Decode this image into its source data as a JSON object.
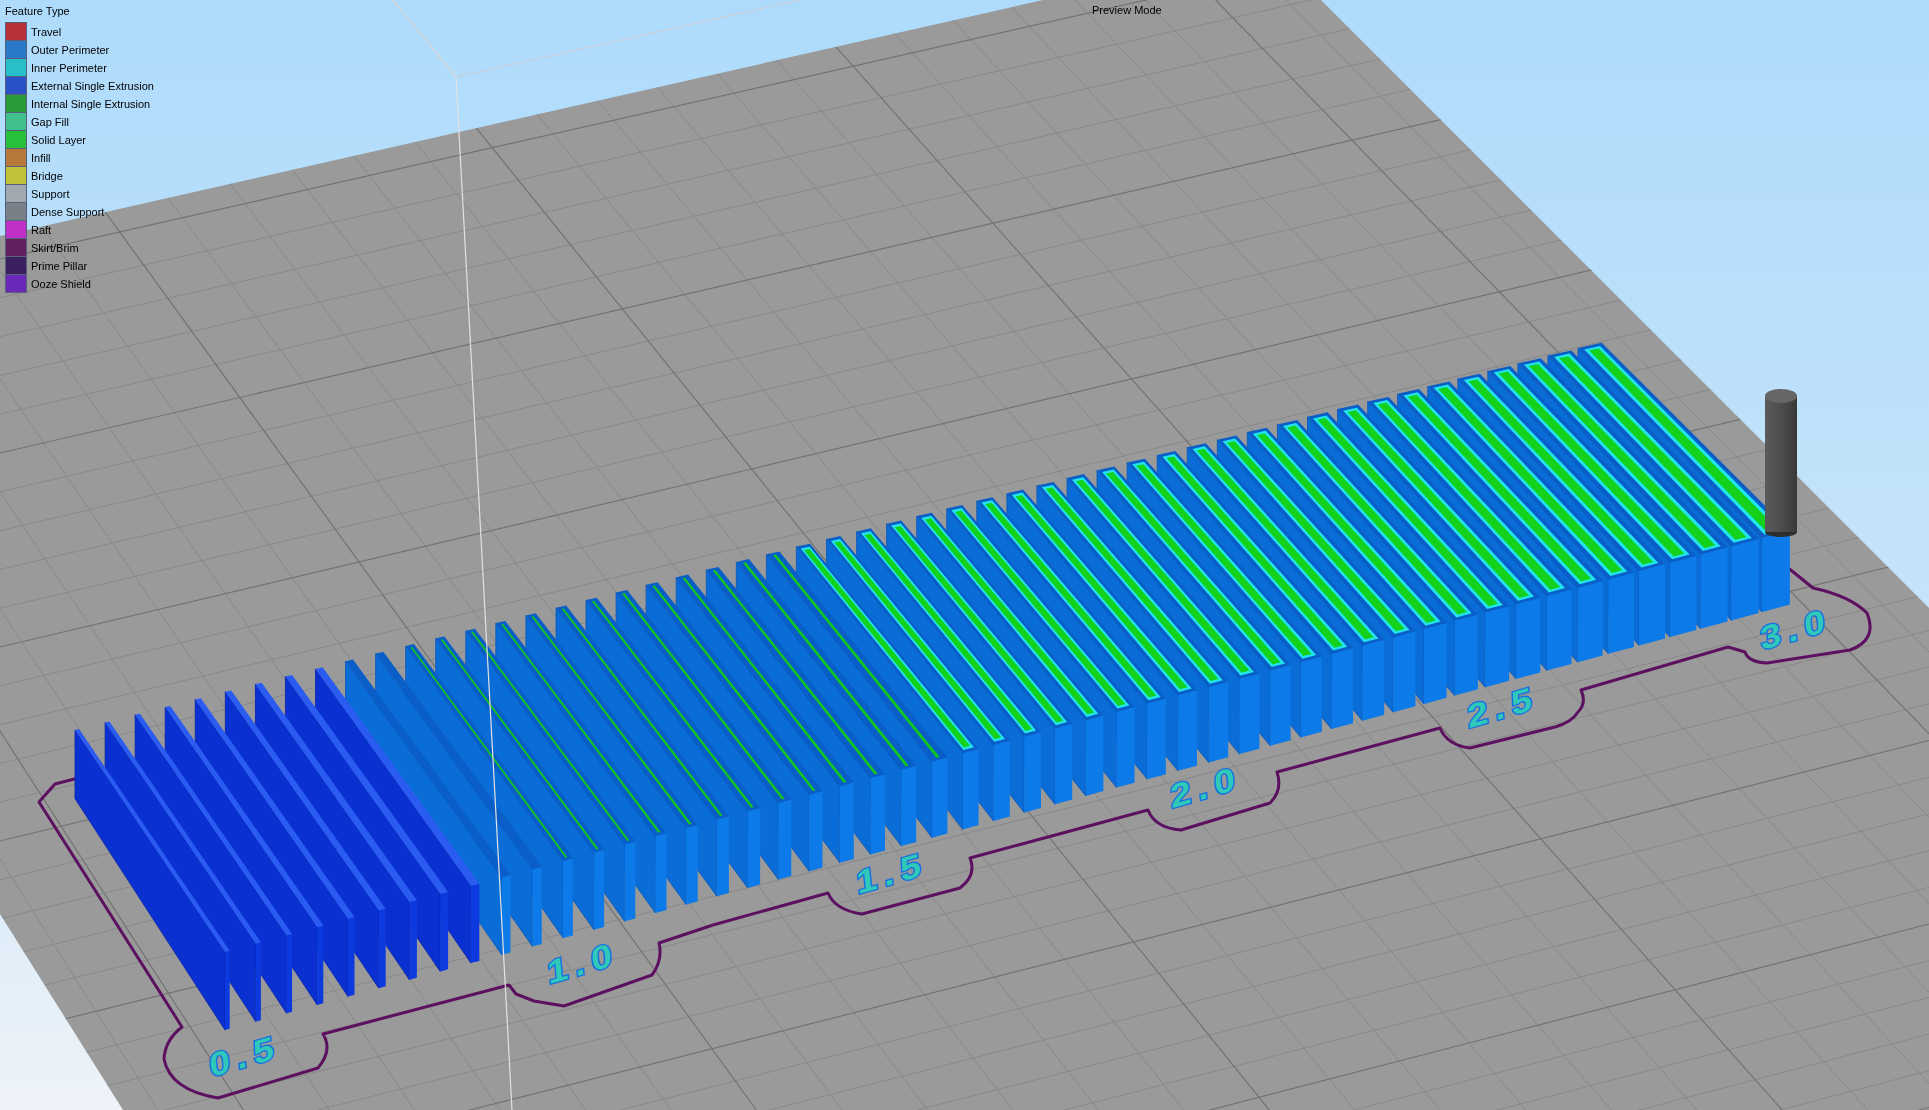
{
  "legend": {
    "title": "Feature Type",
    "items": [
      {
        "label": "Travel",
        "color": "#b8323a"
      },
      {
        "label": "Outer Perimeter",
        "color": "#2a78c8"
      },
      {
        "label": "Inner Perimeter",
        "color": "#28c0c8"
      },
      {
        "label": "External Single Extrusion",
        "color": "#2a50c8"
      },
      {
        "label": "Internal Single Extrusion",
        "color": "#2a9a3a"
      },
      {
        "label": "Gap Fill",
        "color": "#40c08a"
      },
      {
        "label": "Solid Layer",
        "color": "#28c03a"
      },
      {
        "label": "Infill",
        "color": "#b8783a"
      },
      {
        "label": "Bridge",
        "color": "#c0c03a"
      },
      {
        "label": "Support",
        "color": "#a0a8b0"
      },
      {
        "label": "Dense Support",
        "color": "#788088"
      },
      {
        "label": "Raft",
        "color": "#c030c8"
      },
      {
        "label": "Skirt/Brim",
        "color": "#602060"
      },
      {
        "label": "Prime Pillar",
        "color": "#3a2060"
      },
      {
        "label": "Ooze Shield",
        "color": "#6a28b8"
      }
    ]
  },
  "mode_label": "Preview Mode",
  "plate_labels": [
    "0.5",
    "1.0",
    "1.5",
    "2.0",
    "2.5",
    "3.0"
  ]
}
